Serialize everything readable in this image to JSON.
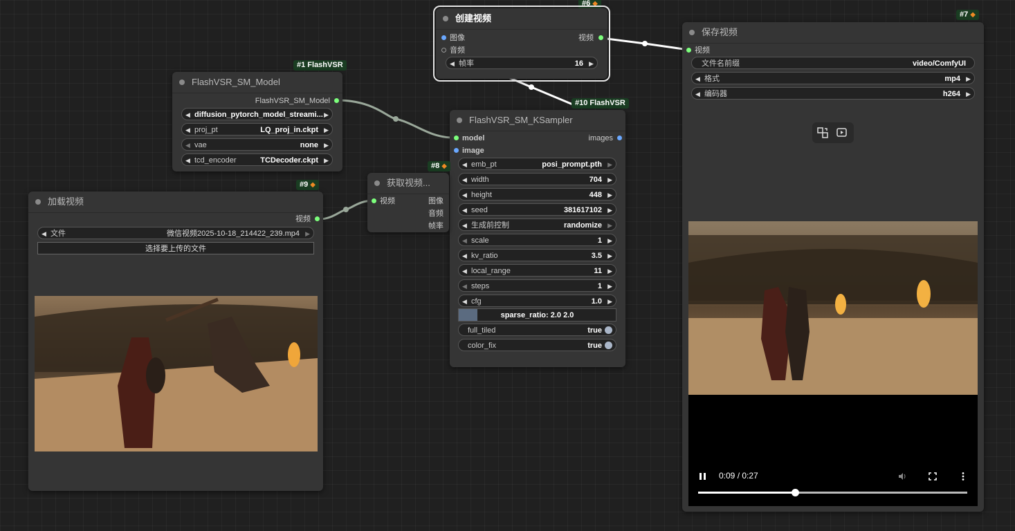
{
  "links": {
    "wire_color": "#9aa89a",
    "white_wire": "#ffffff"
  },
  "nodes": {
    "create_video": {
      "badge": "#6",
      "title": "创建视频",
      "inputs": [
        "图像",
        "音频"
      ],
      "output": "视频",
      "fps": {
        "label": "帧率",
        "value": "16"
      }
    },
    "save_video": {
      "badge": "#7",
      "title": "保存视频",
      "input": "视频",
      "widgets": [
        {
          "label": "文件名前缀",
          "value": "video/ComfyUI"
        },
        {
          "label": "格式",
          "value": "mp4"
        },
        {
          "label": "编码器",
          "value": "h264"
        }
      ],
      "icons": [
        "swap-icon",
        "preview-video-icon"
      ],
      "player": {
        "time": "0:09 / 0:27",
        "progress": 0.36
      }
    },
    "model": {
      "badge": "#1 FlashVSR",
      "title": "FlashVSR_SM_Model",
      "output": "FlashVSR_SM_Model",
      "widgets": [
        {
          "label": "",
          "value": "diffusion_pytorch_model_streami..."
        },
        {
          "label": "proj_pt",
          "value": "LQ_proj_in.ckpt"
        },
        {
          "label": "vae",
          "value": "none"
        },
        {
          "label": "tcd_encoder",
          "value": "TCDecoder.ckpt"
        }
      ]
    },
    "ksampler": {
      "badge": "#10 FlashVSR",
      "title": "FlashVSR_SM_KSampler",
      "inputs": [
        "model",
        "image"
      ],
      "output": "images",
      "widgets": [
        {
          "label": "emb_pt",
          "value": "posi_prompt.pth"
        },
        {
          "label": "width",
          "value": "704"
        },
        {
          "label": "height",
          "value": "448"
        },
        {
          "label": "seed",
          "value": "381617102"
        },
        {
          "label": "生成前控制",
          "value": "randomize"
        },
        {
          "label": "scale",
          "value": "1"
        },
        {
          "label": "kv_ratio",
          "value": "3.5"
        },
        {
          "label": "local_range",
          "value": "11"
        },
        {
          "label": "steps",
          "value": "1"
        },
        {
          "label": "cfg",
          "value": "1.0"
        }
      ],
      "slider": {
        "text": "sparse_ratio: 2.0  2.0",
        "fill": 0.12
      },
      "toggles": [
        {
          "label": "full_tiled",
          "value": "true"
        },
        {
          "label": "color_fix",
          "value": "true"
        }
      ]
    },
    "get_video": {
      "badge": "#8",
      "title": "获取视频...",
      "input": "视频",
      "outputs": [
        "图像",
        "音频",
        "帧率"
      ]
    },
    "load_video": {
      "badge": "#9",
      "title": "加载视频",
      "output": "视频",
      "file": {
        "label": "文件",
        "value": "微信视频2025-10-18_214422_239.mp4"
      },
      "upload": "选择要上传的文件"
    }
  }
}
